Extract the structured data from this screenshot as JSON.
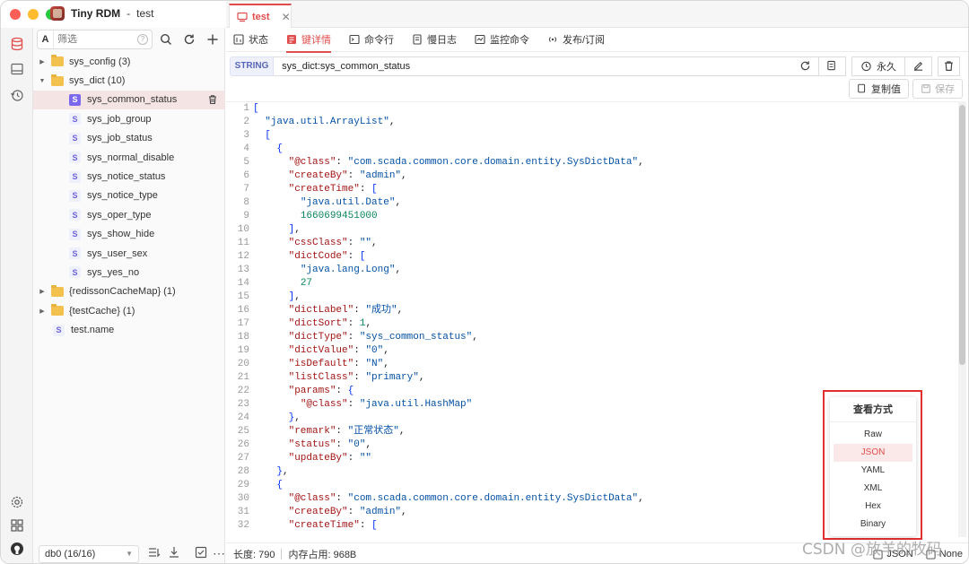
{
  "app": {
    "name": "Tiny RDM",
    "connection": "test",
    "colors": {
      "accent": "#e34c4c",
      "close": "#ff5f57",
      "min": "#febc2e",
      "max": "#28c840"
    }
  },
  "sidebar": {
    "filter_prefix": "A",
    "filter_placeholder": "筛选",
    "filter_help": "?",
    "tree": [
      {
        "label": "sys_config (3)",
        "type": "folder",
        "expanded": false
      },
      {
        "label": "sys_dict (10)",
        "type": "folder",
        "expanded": true
      },
      {
        "label": "sys_common_status",
        "type": "string",
        "selected": true
      },
      {
        "label": "sys_job_group",
        "type": "string"
      },
      {
        "label": "sys_job_status",
        "type": "string"
      },
      {
        "label": "sys_normal_disable",
        "type": "string"
      },
      {
        "label": "sys_notice_status",
        "type": "string"
      },
      {
        "label": "sys_notice_type",
        "type": "string"
      },
      {
        "label": "sys_oper_type",
        "type": "string"
      },
      {
        "label": "sys_show_hide",
        "type": "string"
      },
      {
        "label": "sys_user_sex",
        "type": "string"
      },
      {
        "label": "sys_yes_no",
        "type": "string"
      },
      {
        "label": "{redissonCacheMap} (1)",
        "type": "folder",
        "expanded": false
      },
      {
        "label": "{testCache} (1)",
        "type": "folder",
        "expanded": false
      },
      {
        "label": "test.name",
        "type": "string"
      }
    ],
    "string_badge": "S",
    "db_select": "db0 (16/16)"
  },
  "tab": {
    "label": "test",
    "close": "✕"
  },
  "subtabs": [
    "状态",
    "键详情",
    "命令行",
    "慢日志",
    "监控命令",
    "发布/订阅"
  ],
  "key": {
    "type": "STRING",
    "name": "sys_dict:sys_common_status",
    "ttl": "永久"
  },
  "actions": {
    "copy": "复制值",
    "save": "保存"
  },
  "editor": {
    "lines": [
      "[",
      "  \"java.util.ArrayList\",",
      "  [",
      "    {",
      "      \"@class\": \"com.scada.common.core.domain.entity.SysDictData\",",
      "      \"createBy\": \"admin\",",
      "      \"createTime\": [",
      "        \"java.util.Date\",",
      "        1660699451000",
      "      ],",
      "      \"cssClass\": \"\",",
      "      \"dictCode\": [",
      "        \"java.lang.Long\",",
      "        27",
      "      ],",
      "      \"dictLabel\": \"成功\",",
      "      \"dictSort\": 1,",
      "      \"dictType\": \"sys_common_status\",",
      "      \"dictValue\": \"0\",",
      "      \"isDefault\": \"N\",",
      "      \"listClass\": \"primary\",",
      "      \"params\": {",
      "        \"@class\": \"java.util.HashMap\"",
      "      },",
      "      \"remark\": \"正常状态\",",
      "      \"status\": \"0\",",
      "      \"updateBy\": \"\"",
      "    },",
      "    {",
      "      \"@class\": \"com.scada.common.core.domain.entity.SysDictData\",",
      "      \"createBy\": \"admin\",",
      "      \"createTime\": ["
    ]
  },
  "status": {
    "length": "长度: 790",
    "memory": "内存占用: 968B",
    "format": "JSON",
    "decode": "None"
  },
  "view_menu": {
    "title": "查看方式",
    "options": [
      "Raw",
      "JSON",
      "YAML",
      "XML",
      "Hex",
      "Binary"
    ],
    "active": "JSON"
  },
  "watermark": "CSDN @放羊的牧码"
}
